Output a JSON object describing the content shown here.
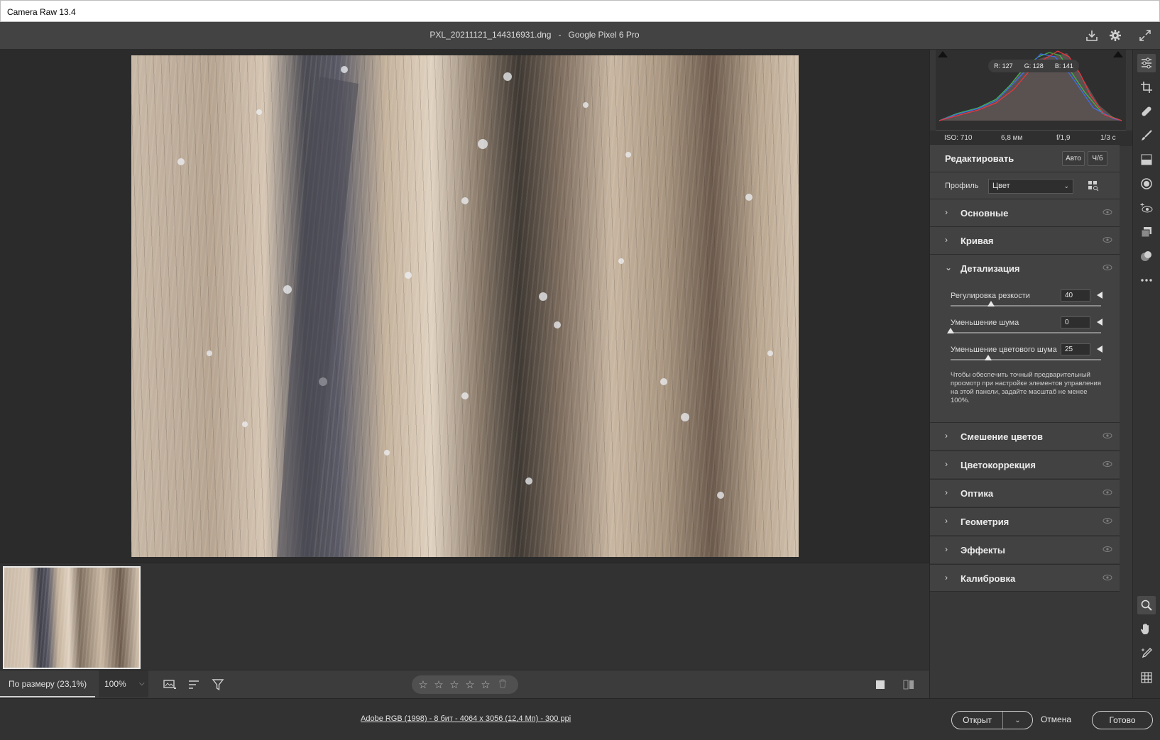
{
  "window": {
    "title": "Camera Raw 13.4"
  },
  "header": {
    "filename": "PXL_20211121_144316931.dng",
    "separator": "-",
    "camera": "Google Pixel 6 Pro"
  },
  "header_icons": [
    "save-icon",
    "settings-icon",
    "fullscreen-icon"
  ],
  "histogram": {
    "r": "R: 127",
    "g": "G: 128",
    "b": "B: 141"
  },
  "exif": {
    "iso": "ISO: 710",
    "focal": "6,8 мм",
    "aperture": "f/1,9",
    "shutter": "1/3 с"
  },
  "edit": {
    "title": "Редактировать",
    "auto_label": "Авто",
    "bw_label": "Ч/б"
  },
  "profile": {
    "label": "Профиль",
    "value": "Цвет"
  },
  "sections": {
    "basic": "Основные",
    "curve": "Кривая",
    "detail": "Детализация",
    "mixer": "Смешение цветов",
    "grading": "Цветокоррекция",
    "optics": "Оптика",
    "geometry": "Геометрия",
    "effects": "Эффекты",
    "calibration": "Калибровка"
  },
  "detail": {
    "sharpening": {
      "label": "Регулировка резкости",
      "value": "40",
      "fraction": 0.27
    },
    "noise": {
      "label": "Уменьшение шума",
      "value": "0",
      "fraction": 0.0
    },
    "color_noise": {
      "label": "Уменьшение цветового шума",
      "value": "25",
      "fraction": 0.25
    },
    "note": "Чтобы обеспечить точный предварительный просмотр при настройке элементов управления на этой панели, задайте масштаб не менее 100%."
  },
  "statusbar": {
    "zoom_fit": "По размеру (23,1%)",
    "zoom_pct": "100%",
    "rating": 0
  },
  "footer": {
    "image_info": "Adobe RGB (1998) - 8 бит - 4064 x 3056 (12,4 Мп) - 300 ppi",
    "open_label": "Открыт",
    "cancel_label": "Отмена",
    "done_label": "Готово"
  },
  "colors": {
    "accent": "#ececec",
    "panel": "#424242",
    "background": "#323232"
  }
}
